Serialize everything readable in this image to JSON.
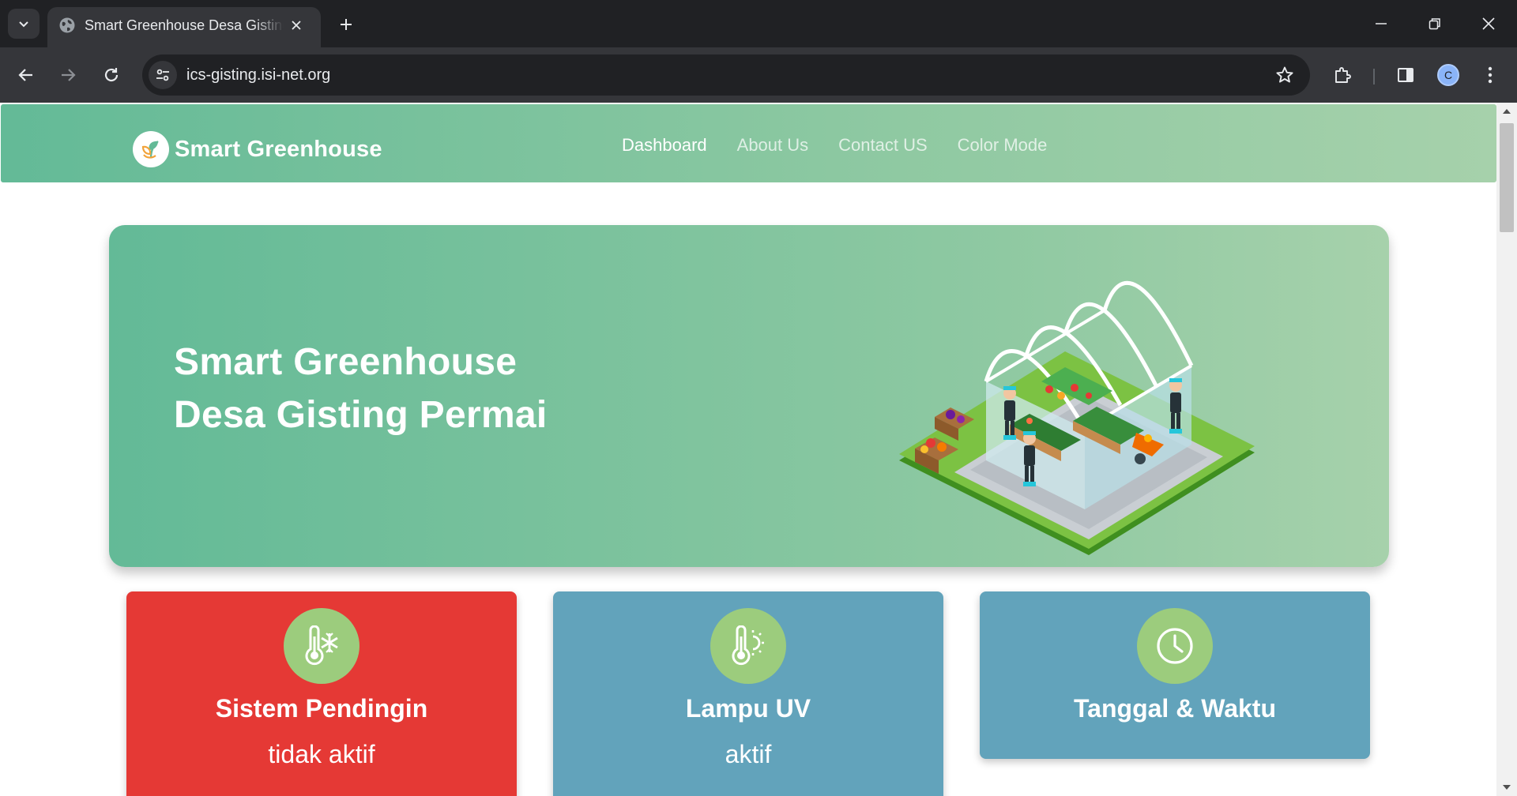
{
  "browser": {
    "tab_title": "Smart Greenhouse Desa Gisting Permai",
    "url": "ics-gisting.isi-net.org",
    "profile_initial": "C"
  },
  "navbar": {
    "brand": "Smart Greenhouse",
    "links": [
      "Dashboard",
      "About Us",
      "Contact US",
      "Color Mode"
    ],
    "active_link": "Dashboard"
  },
  "hero": {
    "title_line1": "Smart Greenhouse",
    "title_line2": "Desa Gisting Permai"
  },
  "cards": [
    {
      "title": "Sistem Pendingin",
      "status": "tidak aktif",
      "icon": "thermometer-snowflake-icon",
      "color": "#e53935"
    },
    {
      "title": "Lampu UV",
      "status": "aktif",
      "icon": "thermometer-sun-icon",
      "color": "#62a3bb"
    },
    {
      "title": "Tanggal & Waktu",
      "icon": "clock-icon",
      "color": "#62a3bb"
    }
  ],
  "colors": {
    "primary_green": "#63ba97",
    "light_green": "#a6d1ab",
    "icon_circle": "#9ccc7d",
    "alert_red": "#e53935",
    "info_blue": "#62a3bb"
  }
}
